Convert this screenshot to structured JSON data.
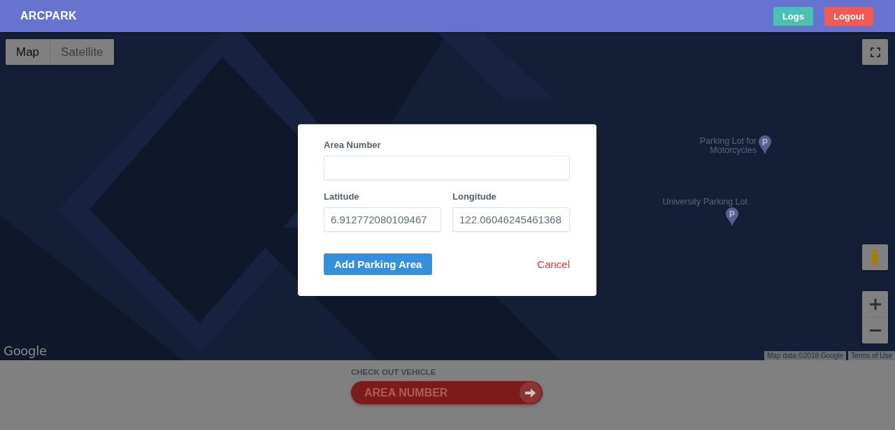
{
  "navbar": {
    "brand": "ARCPARK",
    "buttons": [
      {
        "label": "Logs",
        "kind": "logs"
      },
      {
        "label": "Logout",
        "kind": "logout"
      }
    ]
  },
  "map": {
    "type_control": [
      {
        "label": "Map",
        "selected": true
      },
      {
        "label": "Satellite",
        "selected": false
      }
    ],
    "places": [
      {
        "name": "Parking Lot for Motorcycles",
        "marker": "P",
        "kind": "left"
      },
      {
        "name": "University Parking Lot",
        "marker": "P",
        "kind": "above"
      }
    ],
    "logo": "Google",
    "attribution": "Map data ©2018 Google",
    "terms_link": "Terms of Use"
  },
  "dialog": {
    "rows": [
      {
        "fields": [
          {
            "label": "Area Number"
          }
        ]
      },
      {
        "fields": [
          {
            "label": "Latitude",
            "value": "6.912772080109467"
          },
          {
            "label": "Longitude",
            "value": "122.06046245461368"
          }
        ]
      }
    ],
    "actions": [
      {
        "label": "Add Parking Area",
        "kind": "primary"
      },
      {
        "label": "Cancel",
        "kind": "cancel"
      }
    ]
  },
  "checkout": {
    "title": "CHECK OUT VEHICLE",
    "placeholder": "AREA NUMBER"
  }
}
